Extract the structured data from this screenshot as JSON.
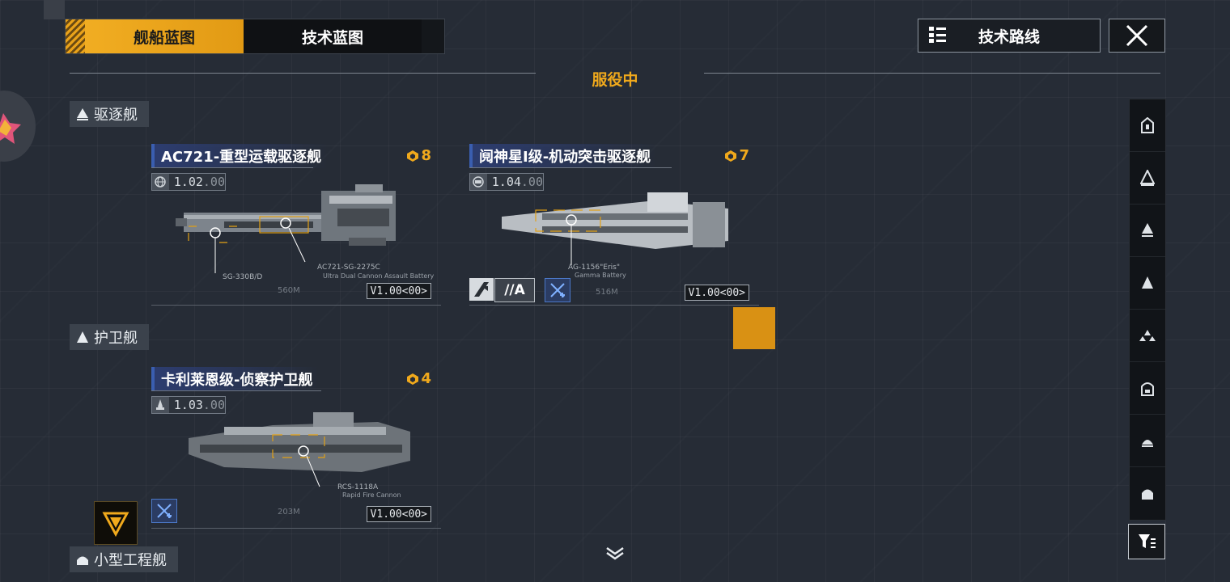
{
  "tabs": [
    {
      "label": "舰船蓝图",
      "active": true
    },
    {
      "label": "技术蓝图",
      "active": false
    }
  ],
  "roadmap_button": {
    "label": "技术路线"
  },
  "status_text": "服役中",
  "categories": [
    {
      "label": "驱逐舰"
    },
    {
      "label": "护卫舰"
    },
    {
      "label": "小型工程舰"
    }
  ],
  "ships": [
    {
      "name": "AC721-重型运载驱逐舰",
      "count": "8",
      "version_main": "1.02",
      "version_sub": ".00",
      "weapon_a": "SG-330B/D",
      "weapon_b": "AC721-SG-2275C",
      "weapon_b_sub": "Ultra Dual Cannon Assault Battery",
      "length": "560M",
      "badge": "V1.00<00>"
    },
    {
      "name": "阋神星I级-机动突击驱逐舰",
      "count": "7",
      "version_main": "1.04",
      "version_sub": ".00",
      "weapon_a": "AG-1156\"Eris\"",
      "weapon_a_sub": "Gamma Battery",
      "length": "516M",
      "badge": "V1.00<00>",
      "skills": [
        "//A"
      ]
    },
    {
      "name": "卡利莱恩级-侦察护卫舰",
      "count": "4",
      "version_main": "1.03",
      "version_sub": ".00",
      "weapon_a": "RCS-1118A",
      "weapon_a_sub": "Rapid Fire Cannon",
      "length": "203M",
      "badge": "V1.00<00>"
    }
  ],
  "colors": {
    "accent": "#f0a91c",
    "title_bar": "#2c3c6e",
    "background": "#262c36"
  },
  "icons": {
    "close": "close-icon",
    "roadmap": "tech-tree-icon",
    "filter": "filter-icon",
    "expand": "chevron-down-icon"
  }
}
